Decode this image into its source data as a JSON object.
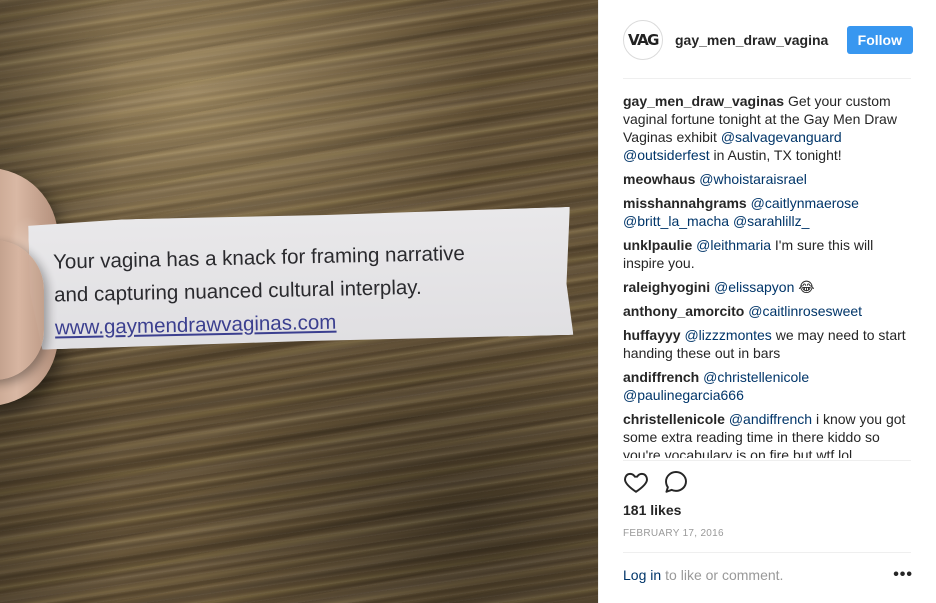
{
  "post": {
    "photo": {
      "fortune_lines": [
        "Your vagina has a knack for framing narrative",
        "and capturing nuanced cultural interplay."
      ],
      "fortune_url": "www.gaymendrawvaginas.com"
    },
    "header": {
      "avatar_text": "VAG",
      "username": "gay_men_draw_vagina",
      "follow_label": "Follow"
    },
    "comments": [
      {
        "user": "gay_men_draw_vaginas",
        "parts": [
          {
            "t": "text",
            "v": " Get your custom vaginal fortune tonight at the Gay Men Draw Vaginas exhibit "
          },
          {
            "t": "mention",
            "v": "@salvagevanguard"
          },
          {
            "t": "text",
            "v": " "
          },
          {
            "t": "mention",
            "v": "@outsiderfest"
          },
          {
            "t": "text",
            "v": " in Austin, TX tonight!"
          }
        ]
      },
      {
        "user": "meowhaus",
        "parts": [
          {
            "t": "text",
            "v": " "
          },
          {
            "t": "mention",
            "v": "@whoistaraisrael"
          }
        ]
      },
      {
        "user": "misshannahgrams",
        "parts": [
          {
            "t": "text",
            "v": " "
          },
          {
            "t": "mention",
            "v": "@caitlynmaerose"
          },
          {
            "t": "text",
            "v": " "
          },
          {
            "t": "mention",
            "v": "@britt_la_macha"
          },
          {
            "t": "text",
            "v": " "
          },
          {
            "t": "mention",
            "v": "@sarahlillz_"
          }
        ]
      },
      {
        "user": "unklpaulie",
        "parts": [
          {
            "t": "text",
            "v": " "
          },
          {
            "t": "mention",
            "v": "@leithmaria"
          },
          {
            "t": "text",
            "v": " I'm sure this will inspire you."
          }
        ]
      },
      {
        "user": "raleighyogini",
        "parts": [
          {
            "t": "text",
            "v": " "
          },
          {
            "t": "mention",
            "v": "@elissapyon"
          },
          {
            "t": "text",
            "v": " 😂"
          }
        ]
      },
      {
        "user": "anthony_amorcito",
        "parts": [
          {
            "t": "text",
            "v": " "
          },
          {
            "t": "mention",
            "v": "@caitlinrosesweet"
          }
        ]
      },
      {
        "user": "huffayyy",
        "parts": [
          {
            "t": "text",
            "v": " "
          },
          {
            "t": "mention",
            "v": "@lizzzmontes"
          },
          {
            "t": "text",
            "v": " we may need to start handing these out in bars"
          }
        ]
      },
      {
        "user": "andiffrench",
        "parts": [
          {
            "t": "text",
            "v": " "
          },
          {
            "t": "mention",
            "v": "@christellenicole"
          },
          {
            "t": "text",
            "v": " "
          },
          {
            "t": "mention",
            "v": "@paulinegarcia666"
          }
        ]
      },
      {
        "user": "christellenicole",
        "parts": [
          {
            "t": "text",
            "v": " "
          },
          {
            "t": "mention",
            "v": "@andiffrench"
          },
          {
            "t": "text",
            "v": " i know you got some extra reading time in there kiddo so you're vocabulary is on fire but wtf lol"
          }
        ]
      }
    ],
    "actions": {
      "like_icon": "heart-icon",
      "comment_icon": "speech-bubble-icon"
    },
    "likes": "181 likes",
    "date": "FEBRUARY 17, 2016",
    "footer": {
      "login_label": "Log in",
      "login_suffix": "to like or comment.",
      "more_icon": "more-dots-icon",
      "more_glyph": "•••"
    }
  },
  "colors": {
    "follow_button": "#3897f0",
    "mention": "#003569",
    "muted": "#999999"
  }
}
